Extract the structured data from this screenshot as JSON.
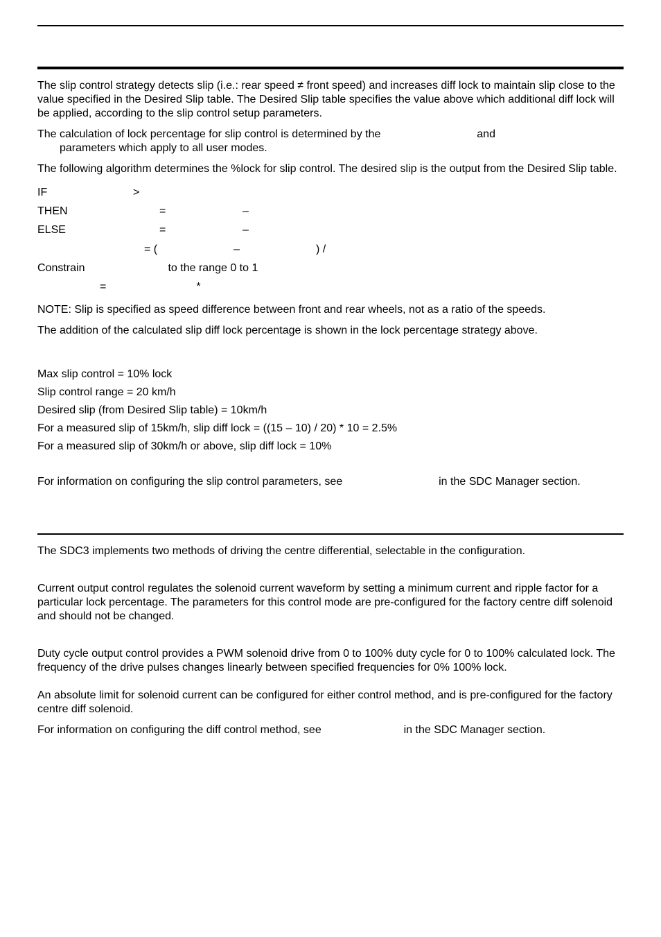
{
  "paragraphs": {
    "p1": "The slip control strategy detects slip (i.e.: rear speed ≠ front speed) and increases diff lock to maintain slip close to the value specified in the Desired Slip table. The Desired Slip table specifies the value above which additional diff lock will be applied, according to the slip control setup parameters.",
    "p2a": "The calculation of lock percentage for slip control is determined by the ",
    "p2b": " and ",
    "p2c": " parameters which apply to all user modes.",
    "p3": "The following algorithm determines the %lock for slip control. The desired slip is the output from the Desired Slip table."
  },
  "algo": {
    "if": "IF",
    "gt": ">",
    "then": "THEN",
    "eq": "=",
    "minus": "–",
    "else": "ELSE",
    "eqopen": "= (",
    "closeparen_div": ") /",
    "constrain": "Constrain",
    "range": "to the range 0 to 1",
    "star": "*"
  },
  "note": "NOTE: Slip is specified as speed difference between front and rear wheels, not as a ratio of the speeds.",
  "addition": "The addition of the calculated slip diff lock percentage is shown in the lock percentage strategy above.",
  "example": {
    "l1": "Max slip control = 10% lock",
    "l2": "Slip control range = 20 km/h",
    "l3": "Desired slip (from Desired Slip table) = 10km/h",
    "l4": "For a measured slip of 15km/h, slip diff lock = ((15 – 10) / 20) * 10 = 2.5%",
    "l5": "For a measured slip of 30km/h or above, slip diff lock = 10%"
  },
  "info1a": "For information on configuring the slip control parameters, see ",
  "info1b": " in the SDC Manager section.",
  "section2": {
    "intro": "The SDC3 implements two methods of driving the centre differential, selectable in the configuration.",
    "current": "Current output control regulates the solenoid current waveform by setting a minimum current and ripple factor for a particular lock percentage. The parameters for this control mode are pre-configured for the factory centre diff solenoid and should not be changed.",
    "duty": "Duty cycle output control provides a PWM solenoid drive from 0 to 100% duty cycle for 0 to 100% calculated lock. The frequency of the drive pulses changes linearly between specified frequencies for 0% 100% lock.",
    "limit": "An absolute limit for solenoid current can be configured for either control method, and is pre-configured for the factory centre diff solenoid.",
    "info2a": "For information on configuring the diff control method, see ",
    "info2b": " in the SDC Manager section."
  }
}
